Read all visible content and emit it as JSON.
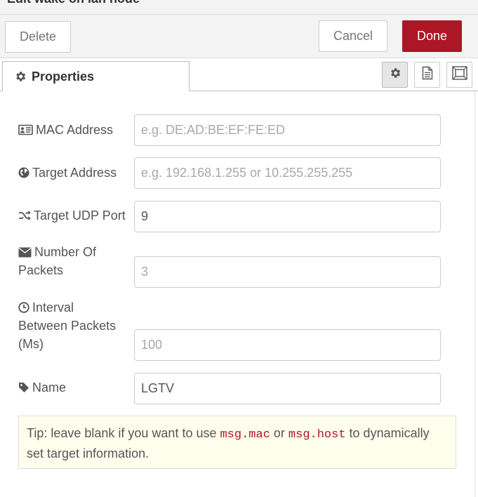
{
  "dialog": {
    "title": "Edit wake on lan node"
  },
  "toolbar": {
    "delete_label": "Delete",
    "cancel_label": "Cancel",
    "done_label": "Done"
  },
  "tabs": {
    "properties_label": "Properties",
    "icons": [
      "gear-icon",
      "description-icon",
      "appearance-icon"
    ]
  },
  "form": {
    "mac": {
      "label": "MAC Address",
      "value": "",
      "placeholder": "e.g. DE:AD:BE:EF:FE:ED",
      "icon": "id-card-icon"
    },
    "target": {
      "label": "Target Address",
      "value": "",
      "placeholder": "e.g. 192.168.1.255 or 10.255.255.255",
      "icon": "globe-icon"
    },
    "port": {
      "label": "Target UDP Port",
      "value": "9",
      "placeholder": "",
      "icon": "random-icon"
    },
    "packets": {
      "label_line1": "Number Of",
      "label_line2": "Packets",
      "value": "",
      "placeholder": "3",
      "icon": "envelope-icon"
    },
    "interval": {
      "label_line1": "Interval",
      "label_line2": "Between Packets",
      "label_line3": "(Ms)",
      "value": "",
      "placeholder": "100",
      "icon": "clock-icon"
    },
    "name": {
      "label": "Name",
      "value": "LGTV",
      "placeholder": "",
      "icon": "tag-icon"
    }
  },
  "tip": {
    "prefix": "Tip: leave blank if you want to use ",
    "code1": "msg.mac",
    "middle": " or ",
    "code2": "msg.host",
    "suffix": " to dynamically set target information."
  },
  "colors": {
    "primary": "#ad1625",
    "tip_background": "#ffffee",
    "code": "#ad1625"
  }
}
